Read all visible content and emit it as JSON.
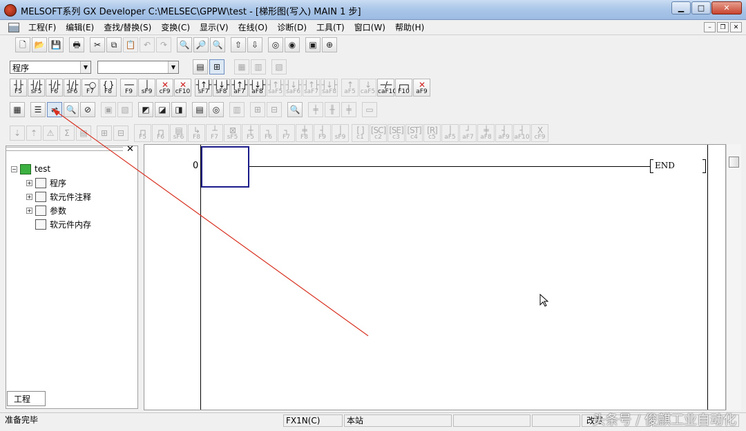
{
  "window": {
    "title": "MELSOFT系列 GX Developer C:\\MELSEC\\GPPW\\test - [梯形图(写入)    MAIN    1 步]",
    "min_label": "▁",
    "max_label": "□",
    "close_label": "✕"
  },
  "menu": [
    "工程(F)",
    "编辑(E)",
    "查找/替换(S)",
    "变换(C)",
    "显示(V)",
    "在线(O)",
    "诊断(D)",
    "工具(T)",
    "窗口(W)",
    "帮助(H)"
  ],
  "mdi": {
    "min": "–",
    "restore": "❐",
    "close": "✕"
  },
  "selectors": {
    "program_type": "程序",
    "second": ""
  },
  "fkeys_row": [
    {
      "sym": "┤├",
      "label": "F5"
    },
    {
      "sym": "┤/├",
      "label": "sF5"
    },
    {
      "sym": "┤/├",
      "label": "F6"
    },
    {
      "sym": "┤/├",
      "label": "sF6"
    },
    {
      "sym": "─○",
      "label": "F7"
    },
    {
      "sym": "{ }",
      "label": "F8"
    },
    {
      "sym": "──",
      "label": "F9"
    },
    {
      "sym": "│",
      "label": "sF9"
    },
    {
      "sym": "✕",
      "label": "cF9"
    },
    {
      "sym": "✕",
      "label": "cF10"
    },
    {
      "sym": "┤↑├",
      "label": "sF7"
    },
    {
      "sym": "┤↓├",
      "label": "sF8"
    },
    {
      "sym": "┤↑├",
      "label": "aF7"
    },
    {
      "sym": "┤↓├",
      "label": "aF8"
    },
    {
      "sym": "┤↑├",
      "label": "saF5"
    },
    {
      "sym": "┤↓├",
      "label": "saF6"
    },
    {
      "sym": "┤↑├",
      "label": "saF7"
    },
    {
      "sym": "┤↓├",
      "label": "saF8"
    },
    {
      "sym": "↑",
      "label": "aF5"
    },
    {
      "sym": "↓",
      "label": "caF5"
    },
    {
      "sym": "─/─",
      "label": "caF10"
    },
    {
      "sym": "┌─┐",
      "label": "F10"
    },
    {
      "sym": "✕",
      "label": "aF9"
    }
  ],
  "instr_row": [
    {
      "sym": "┌┐",
      "label": "F5"
    },
    {
      "sym": "┌┐",
      "label": "F6"
    },
    {
      "sym": "▤",
      "label": "sF6"
    },
    {
      "sym": "↳",
      "label": "F8"
    },
    {
      "sym": "┴",
      "label": "F7"
    },
    {
      "sym": "⊠",
      "label": "sF5"
    },
    {
      "sym": "┼",
      "label": "F5"
    },
    {
      "sym": "┐",
      "label": "F6"
    },
    {
      "sym": "┐",
      "label": "F7"
    },
    {
      "sym": "╪",
      "label": "F8"
    },
    {
      "sym": "┤",
      "label": "F9"
    },
    {
      "sym": "│",
      "label": "sF9"
    },
    {
      "sym": "[ ]",
      "label": "c1"
    },
    {
      "sym": "[SC]",
      "label": "c2"
    },
    {
      "sym": "[SE]",
      "label": "c3"
    },
    {
      "sym": "[ST]",
      "label": "c4"
    },
    {
      "sym": "[R]",
      "label": "c5"
    },
    {
      "sym": "│",
      "label": "aF5"
    },
    {
      "sym": "┘",
      "label": "aF7"
    },
    {
      "sym": "╪",
      "label": "aF8"
    },
    {
      "sym": "┤",
      "label": "aF9"
    },
    {
      "sym": "┤",
      "label": "aF10"
    },
    {
      "sym": "X",
      "label": "cF9"
    }
  ],
  "tree": {
    "root": "test",
    "items": [
      "程序",
      "软元件注释",
      "参数",
      "软元件内存"
    ]
  },
  "panel_tab": "工程",
  "panel_close": "✕",
  "ladder": {
    "step": "0",
    "end_label": "END"
  },
  "status": {
    "ready": "准备完毕",
    "plc": "FX1N(C)",
    "station": "本站",
    "overwrite": "改写"
  },
  "watermark": "头条号 / 俊麒工业自动化",
  "colors": {
    "annotation_line": "#d83020",
    "cursor": "#1a1a8a"
  }
}
